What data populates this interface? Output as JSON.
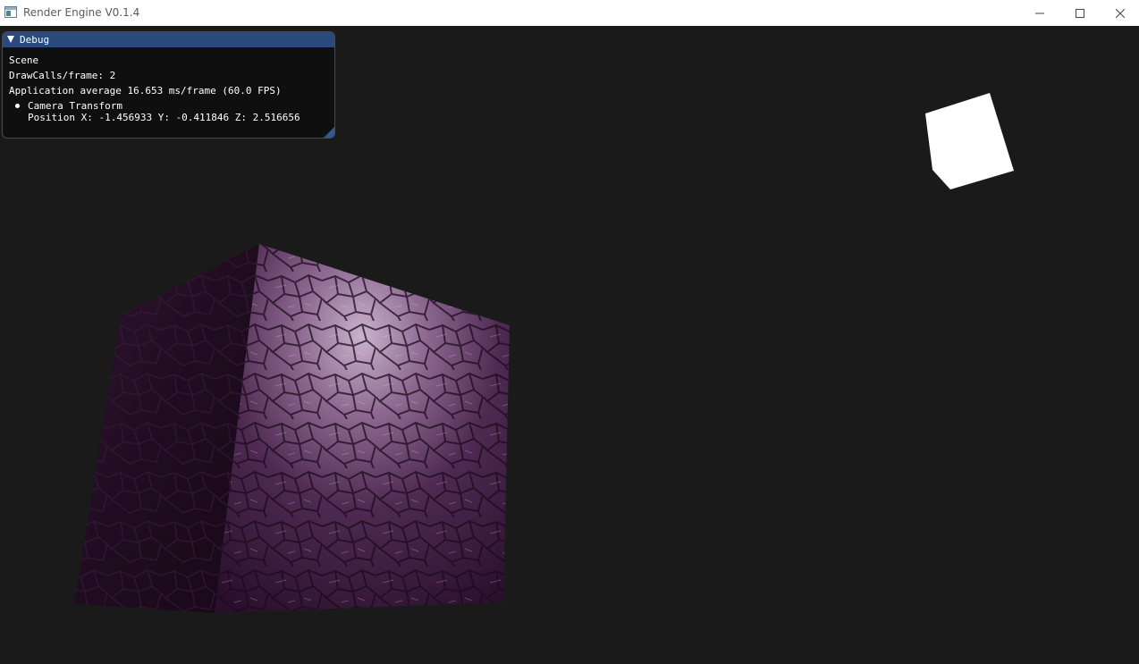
{
  "window": {
    "title": "Render Engine V0.1.4",
    "icon": "app-window-icon",
    "controls": {
      "minimize_icon": "minimize-icon",
      "maximize_icon": "maximize-icon",
      "close_icon": "close-icon"
    }
  },
  "debug": {
    "title": "Debug",
    "section": "Scene",
    "draw_calls": "DrawCalls/frame: 2",
    "app_average": "Application average 16.653 ms/frame (60.0 FPS)",
    "camera_node": "Camera Transform",
    "camera_position": "Position X: -1.456933 Y: -0.411846 Z: 2.516656"
  },
  "colors": {
    "background": "#1a1a1a",
    "debug_header": "#294a7a",
    "cube_purple": "#6b3c6b",
    "light_cube": "#ffffff"
  }
}
